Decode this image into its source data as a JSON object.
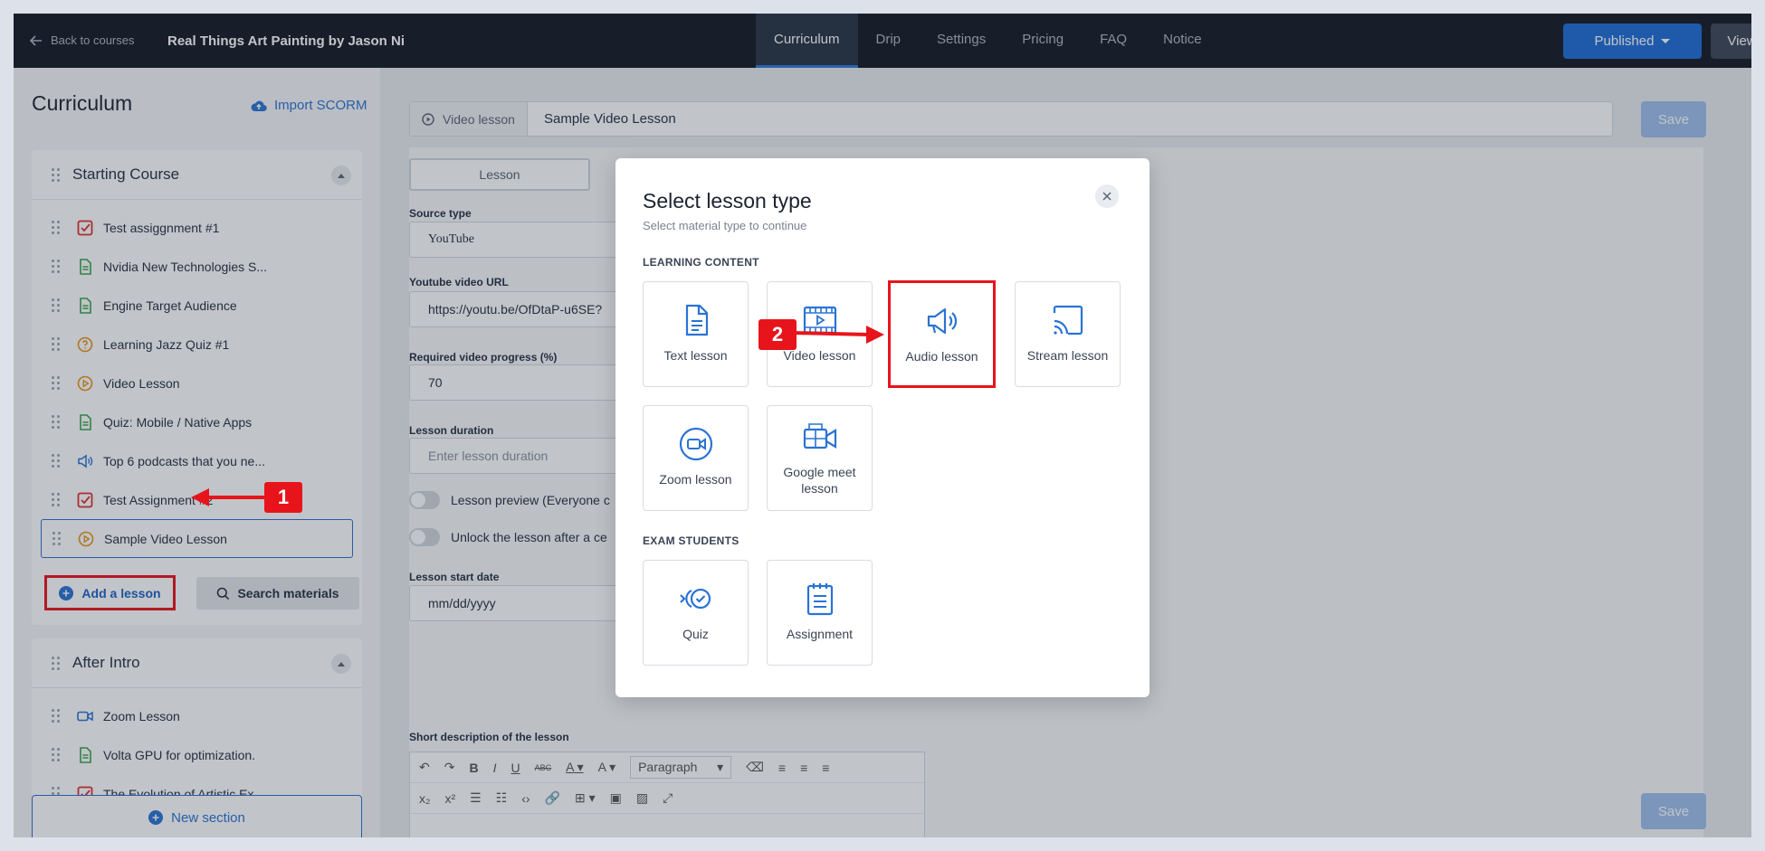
{
  "topbar": {
    "back_label": "Back to courses",
    "course_title": "Real Things Art Painting by Jason Ni",
    "tabs": [
      {
        "label": "Curriculum",
        "active": true
      },
      {
        "label": "Drip"
      },
      {
        "label": "Settings"
      },
      {
        "label": "Pricing"
      },
      {
        "label": "FAQ"
      },
      {
        "label": "Notice"
      }
    ],
    "published_label": "Published",
    "view_label": "View"
  },
  "sidebar": {
    "title": "Curriculum",
    "import_label": "Import SCORM",
    "sections": [
      {
        "name": "Starting Course",
        "lessons": [
          {
            "label": "Test assiggnment #1",
            "icon": "assignment-icon"
          },
          {
            "label": "Nvidia New Technologies S...",
            "icon": "text-lesson-icon"
          },
          {
            "label": "Engine Target Audience",
            "icon": "text-lesson-icon"
          },
          {
            "label": "Learning Jazz Quiz #1",
            "icon": "quiz-icon"
          },
          {
            "label": "Video Lesson",
            "icon": "video-lesson-icon"
          },
          {
            "label": "Quiz: Mobile / Native Apps",
            "icon": "text-lesson-icon"
          },
          {
            "label": "Top 6 podcasts that you ne...",
            "icon": "audio-lesson-icon"
          },
          {
            "label": "Test Assignment #2",
            "icon": "assignment-icon"
          },
          {
            "label": "Sample Video Lesson",
            "icon": "video-lesson-icon",
            "selected": true
          }
        ],
        "add_lesson_label": "Add a lesson",
        "search_materials_label": "Search materials"
      },
      {
        "name": "After Intro",
        "lessons": [
          {
            "label": "Zoom Lesson",
            "icon": "zoom-icon"
          },
          {
            "label": "Volta GPU for optimization.",
            "icon": "text-lesson-icon"
          },
          {
            "label": "The Evolution of Artistic Ex...",
            "icon": "assignment-icon"
          }
        ]
      }
    ],
    "new_section_label": "New section"
  },
  "editor": {
    "type_label": "Video lesson",
    "lesson_title": "Sample Video Lesson",
    "save_label": "Save",
    "tab_lesson": "Lesson",
    "source_type_label": "Source type",
    "source_type_value": "YouTube",
    "youtube_url_label": "Youtube video URL",
    "youtube_url_value": "https://youtu.be/OfDtaP-u6SE?",
    "progress_label": "Required video progress (%)",
    "progress_value": "70",
    "duration_label": "Lesson duration",
    "duration_placeholder": "Enter lesson duration",
    "preview_label": "Lesson preview (Everyone c",
    "unlock_label": "Unlock the lesson after a ce",
    "start_date_label": "Lesson start date",
    "start_date_placeholder": "mm/dd/yyyy",
    "short_desc_label": "Short description of the lesson",
    "paragraph_label": "Paragraph"
  },
  "modal": {
    "title": "Select lesson type",
    "subtitle": "Select material type to continue",
    "group_learning": "LEARNING CONTENT",
    "group_exam": "EXAM STUDENTS",
    "learning_types": [
      {
        "label": "Text lesson",
        "icon": "text-lesson-icon"
      },
      {
        "label": "Video lesson",
        "icon": "video-lesson-icon"
      },
      {
        "label": "Audio lesson",
        "icon": "audio-lesson-icon",
        "highlighted": true
      },
      {
        "label": "Stream lesson",
        "icon": "stream-lesson-icon"
      },
      {
        "label": "Zoom lesson",
        "icon": "zoom-icon"
      },
      {
        "label": "Google meet lesson",
        "icon": "google-meet-icon"
      }
    ],
    "exam_types": [
      {
        "label": "Quiz",
        "icon": "quiz-icon"
      },
      {
        "label": "Assignment",
        "icon": "assignment-icon"
      }
    ]
  },
  "callouts": {
    "step1": "1",
    "step2": "2"
  },
  "colors": {
    "accent": "#1f6dd6",
    "highlight": "#e8141c",
    "topbar": "#141924"
  }
}
